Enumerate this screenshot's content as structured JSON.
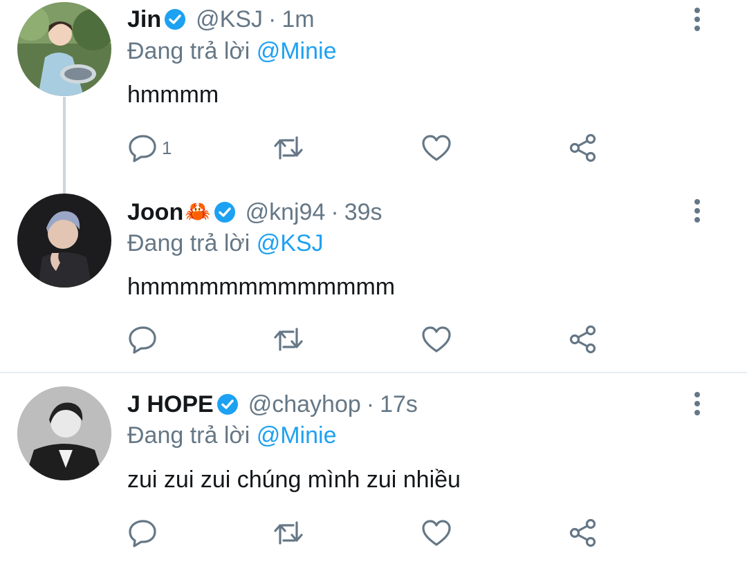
{
  "reply_prefix": "Đang trả lời",
  "tweets": [
    {
      "name": "Jin",
      "handle": "@KSJ",
      "separator": "·",
      "time": "1m",
      "reply_to": "@Minie",
      "text": "hmmmm",
      "reply_count": "1"
    },
    {
      "name": "Joon",
      "name_emoji": "🦀",
      "handle": "@knj94",
      "separator": "·",
      "time": "39s",
      "reply_to": "@KSJ",
      "text": "hmmmmmmmmmmmmm",
      "reply_count": ""
    },
    {
      "name": "J HOPE",
      "handle": "@chayhop",
      "separator": "·",
      "time": "17s",
      "reply_to": "@Minie",
      "text": "zui zui zui chúng mình zui nhiều",
      "reply_count": ""
    }
  ],
  "colors": {
    "accent": "#1da1f2",
    "secondary_text": "#657786",
    "primary_text": "#14171a",
    "divider": "#e6ecf0"
  },
  "icons": [
    "verified-badge-icon",
    "more-vertical-icon",
    "reply-icon",
    "retweet-icon",
    "like-icon",
    "share-icon"
  ]
}
